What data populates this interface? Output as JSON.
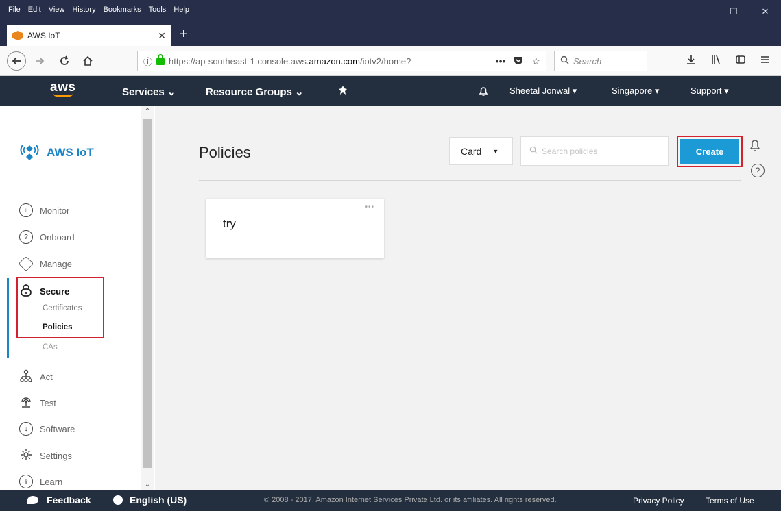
{
  "menubar": {
    "items": [
      "File",
      "Edit",
      "View",
      "History",
      "Bookmarks",
      "Tools",
      "Help"
    ],
    "minimize": "—",
    "maximize": "☐",
    "close": "✕"
  },
  "tab": {
    "title": "AWS IoT",
    "close": "✕",
    "new_tab": "+"
  },
  "nav": {
    "url_prefix": "https://ap-southeast-1.console.aws.",
    "url_domain": "amazon.com",
    "url_suffix": "/iotv2/home?",
    "search_placeholder": "Search",
    "more": "•••"
  },
  "aws_header": {
    "logo": "aws",
    "services": "Services",
    "resource_groups": "Resource Groups",
    "user": "Sheetal Jonwal",
    "region": "Singapore",
    "support": "Support"
  },
  "sidebar": {
    "brand": "AWS IoT",
    "items": {
      "monitor": "Monitor",
      "onboard": "Onboard",
      "manage": "Manage",
      "secure": "Secure",
      "certificates": "Certificates",
      "policies": "Policies",
      "cas": "CAs",
      "act": "Act",
      "test": "Test",
      "software": "Software",
      "settings": "Settings",
      "learn": "Learn"
    }
  },
  "main": {
    "title": "Policies",
    "view_mode": "Card",
    "search_placeholder": "Search policies",
    "create_label": "Create",
    "cards": [
      {
        "name": "try"
      }
    ]
  },
  "footer": {
    "feedback": "Feedback",
    "language": "English (US)",
    "copyright": "© 2008 - 2017, Amazon Internet Services Private Ltd. or its affiliates. All rights reserved.",
    "privacy": "Privacy Policy",
    "terms": "Terms of Use"
  },
  "colors": {
    "aws_dark": "#232f3e",
    "browser_chrome": "#262e4a",
    "accent_blue": "#1b9ad6",
    "highlight_red": "#d0222f",
    "aws_orange": "#ff9900"
  }
}
